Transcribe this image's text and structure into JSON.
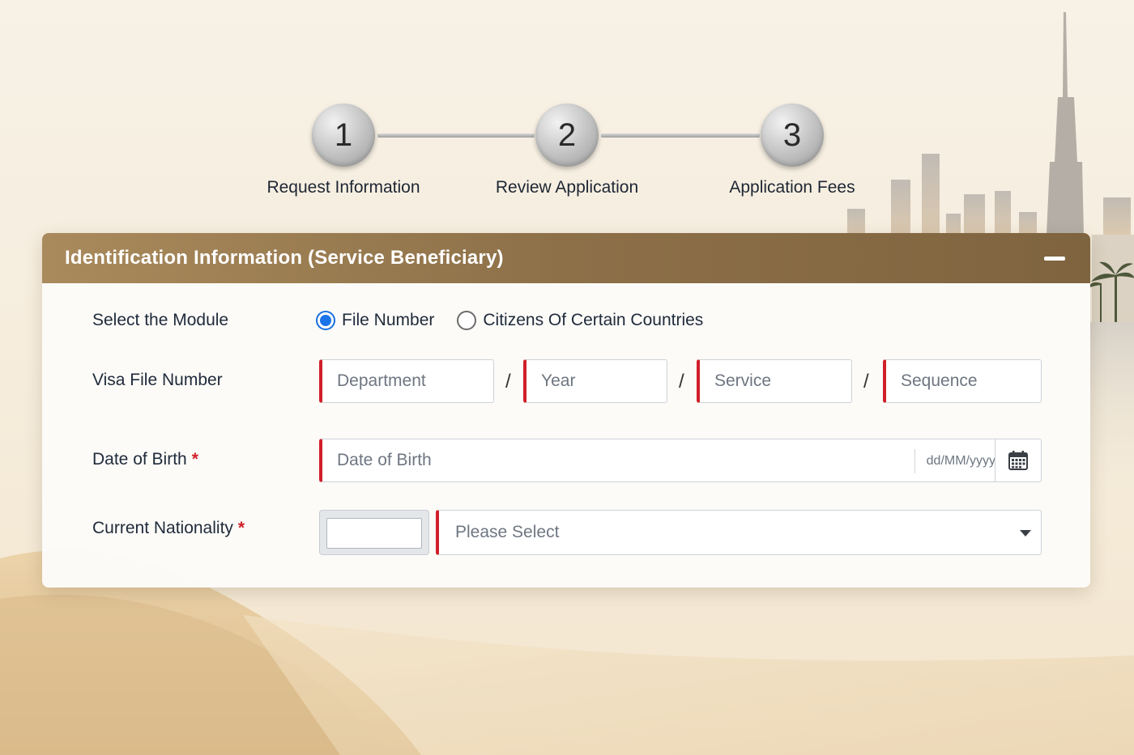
{
  "stepper": {
    "steps": [
      {
        "number": "1",
        "label": "Request Information"
      },
      {
        "number": "2",
        "label": "Review Application"
      },
      {
        "number": "3",
        "label": "Application Fees"
      }
    ]
  },
  "section": {
    "title": "Identification Information (Service Beneficiary)",
    "collapse_icon": "minus-icon"
  },
  "form": {
    "module": {
      "label": "Select the Module",
      "options": [
        {
          "label": "File Number",
          "selected": true
        },
        {
          "label": "Citizens Of Certain Countries",
          "selected": false
        }
      ]
    },
    "visa_file_number": {
      "label": "Visa File Number",
      "separator": "/",
      "parts": [
        {
          "placeholder": "Department"
        },
        {
          "placeholder": "Year"
        },
        {
          "placeholder": "Service"
        },
        {
          "placeholder": "Sequence"
        }
      ]
    },
    "date_of_birth": {
      "label": "Date of Birth",
      "required_mark": "*",
      "placeholder": "Date of Birth",
      "format_hint": "dd/MM/yyyy",
      "icon": "calendar-icon"
    },
    "nationality": {
      "label": "Current Nationality",
      "required_mark": "*",
      "selected": "Please Select",
      "icon": "caret-down-icon"
    }
  },
  "colors": {
    "header_gradient_start": "#a98a5c",
    "header_gradient_end": "#7f6440",
    "required_red": "#d11f2a",
    "radio_blue": "#1a73e8"
  }
}
